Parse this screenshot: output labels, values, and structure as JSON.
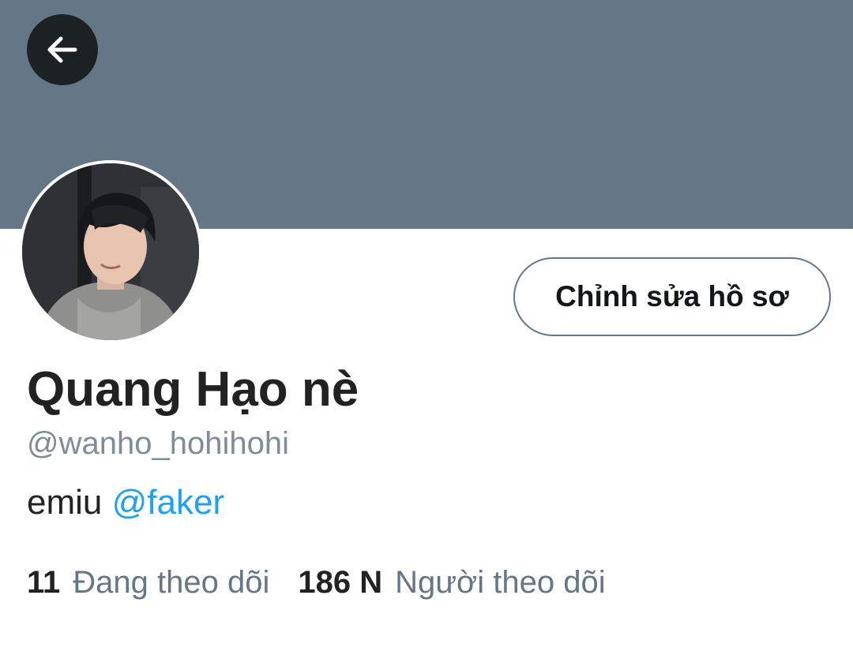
{
  "colors": {
    "banner": "#657786",
    "link": "#1da1f2",
    "muted": "#657786"
  },
  "header": {
    "back_icon": "arrow-left-icon"
  },
  "profile": {
    "avatar_icon": "profile-photo",
    "edit_button_label": "Chỉnh sửa hồ sơ",
    "display_name": "Quang Hạo nè",
    "handle": "@wanho_hohihohi",
    "bio": {
      "text": "emiu ",
      "mention": "@faker"
    }
  },
  "stats": {
    "following": {
      "count": "11",
      "label": "Đang theo dõi"
    },
    "followers": {
      "count": "186 N",
      "label": "Người theo dõi"
    }
  }
}
